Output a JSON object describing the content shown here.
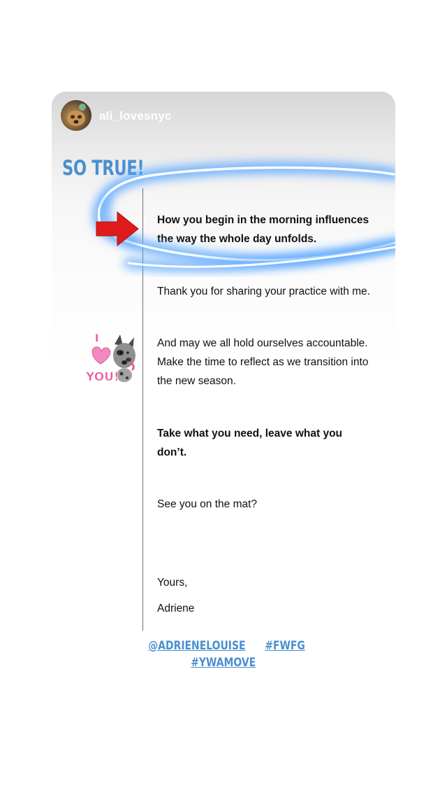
{
  "post": {
    "username": "ali_lovesnyc",
    "caption": "SO TRUE!"
  },
  "document": {
    "highlight_line1": "How you begin in the morning  influences",
    "highlight_line2": "the way the whole day unfolds.",
    "thanks": "Thank you for sharing your practice with me.",
    "para_line1": "And may we all hold ourselves accountable.",
    "para_line2": "Make the time to reflect as we transition into",
    "para_line3": "the new season.",
    "take_line1": "Take what you need, leave what you",
    "take_line2": "don’t.",
    "see_you": "See you on the mat?",
    "yours": "Yours,",
    "signature": "Adriene"
  },
  "tags": {
    "mention": "@ADRIENELOUISE",
    "tag1": "#FWFG",
    "tag2": "#YWAMOVE"
  },
  "sticker": {
    "top": "I",
    "bottom": "YOU!"
  },
  "colors": {
    "accent": "#4a8fd0",
    "arrow": "#e01b1b",
    "glow": "#5aa7ff",
    "sticker_pink": "#ec5aa3"
  },
  "icons": {
    "avatar": "profile-photo",
    "arrow": "red-arrow-right-icon",
    "sticker": "love-you-dog-sticker"
  }
}
